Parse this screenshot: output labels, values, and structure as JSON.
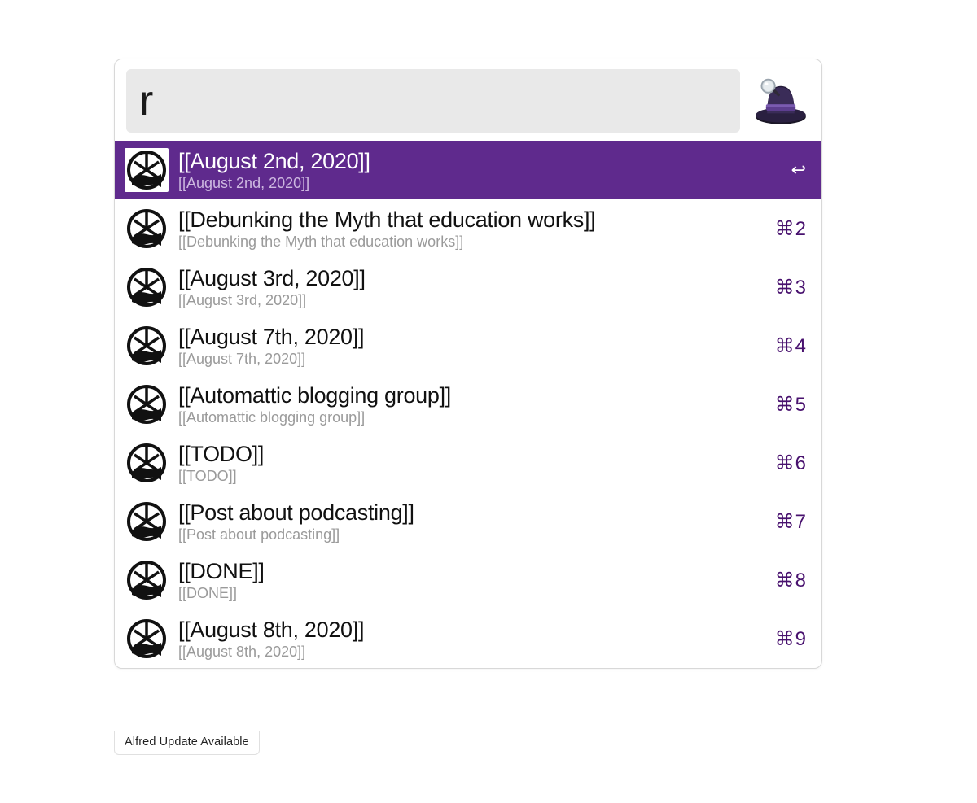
{
  "search": {
    "value": "r",
    "placeholder": ""
  },
  "colors": {
    "selection": "#5f2a8d",
    "shortcut": "#48116e"
  },
  "results": [
    {
      "title": "[[August 2nd, 2020]]",
      "subtitle": "[[August 2nd, 2020]]",
      "shortcut": "↩",
      "selected": true
    },
    {
      "title": "[[Debunking the Myth that education works]]",
      "subtitle": "[[Debunking the Myth that education works]]",
      "shortcut": "⌘2",
      "selected": false
    },
    {
      "title": "[[August 3rd, 2020]]",
      "subtitle": "[[August 3rd, 2020]]",
      "shortcut": "⌘3",
      "selected": false
    },
    {
      "title": "[[August 7th, 2020]]",
      "subtitle": "[[August 7th, 2020]]",
      "shortcut": "⌘4",
      "selected": false
    },
    {
      "title": "[[Automattic blogging group]]",
      "subtitle": "[[Automattic blogging group]]",
      "shortcut": "⌘5",
      "selected": false
    },
    {
      "title": "[[TODO]]",
      "subtitle": "[[TODO]]",
      "shortcut": "⌘6",
      "selected": false
    },
    {
      "title": "[[Post about podcasting]]",
      "subtitle": "[[Post about podcasting]]",
      "shortcut": "⌘7",
      "selected": false
    },
    {
      "title": "[[DONE]]",
      "subtitle": "[[DONE]]",
      "shortcut": "⌘8",
      "selected": false
    },
    {
      "title": "[[August 8th, 2020]]",
      "subtitle": "[[August 8th, 2020]]",
      "shortcut": "⌘9",
      "selected": false
    }
  ],
  "footer": {
    "update_text": "Alfred Update Available"
  },
  "icons": {
    "result_icon_name": "roam-logo-icon",
    "app_icon_name": "alfred-hat-icon"
  }
}
